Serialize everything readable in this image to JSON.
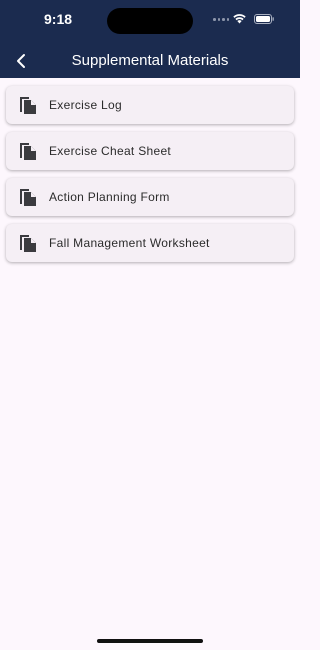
{
  "status_bar": {
    "time": "9:18"
  },
  "header": {
    "title": "Supplemental Materials",
    "back_icon": "chevron-left-icon"
  },
  "materials": [
    {
      "label": "Exercise Log",
      "icon": "document-copy-icon"
    },
    {
      "label": "Exercise Cheat Sheet",
      "icon": "document-copy-icon"
    },
    {
      "label": "Action Planning Form",
      "icon": "document-copy-icon"
    },
    {
      "label": "Fall Management Worksheet",
      "icon": "document-copy-icon"
    }
  ],
  "colors": {
    "header_bg": "#1b2b4f",
    "page_bg": "#fdf7fd",
    "card_bg": "#f5eff5",
    "icon": "#3b3b3f"
  }
}
